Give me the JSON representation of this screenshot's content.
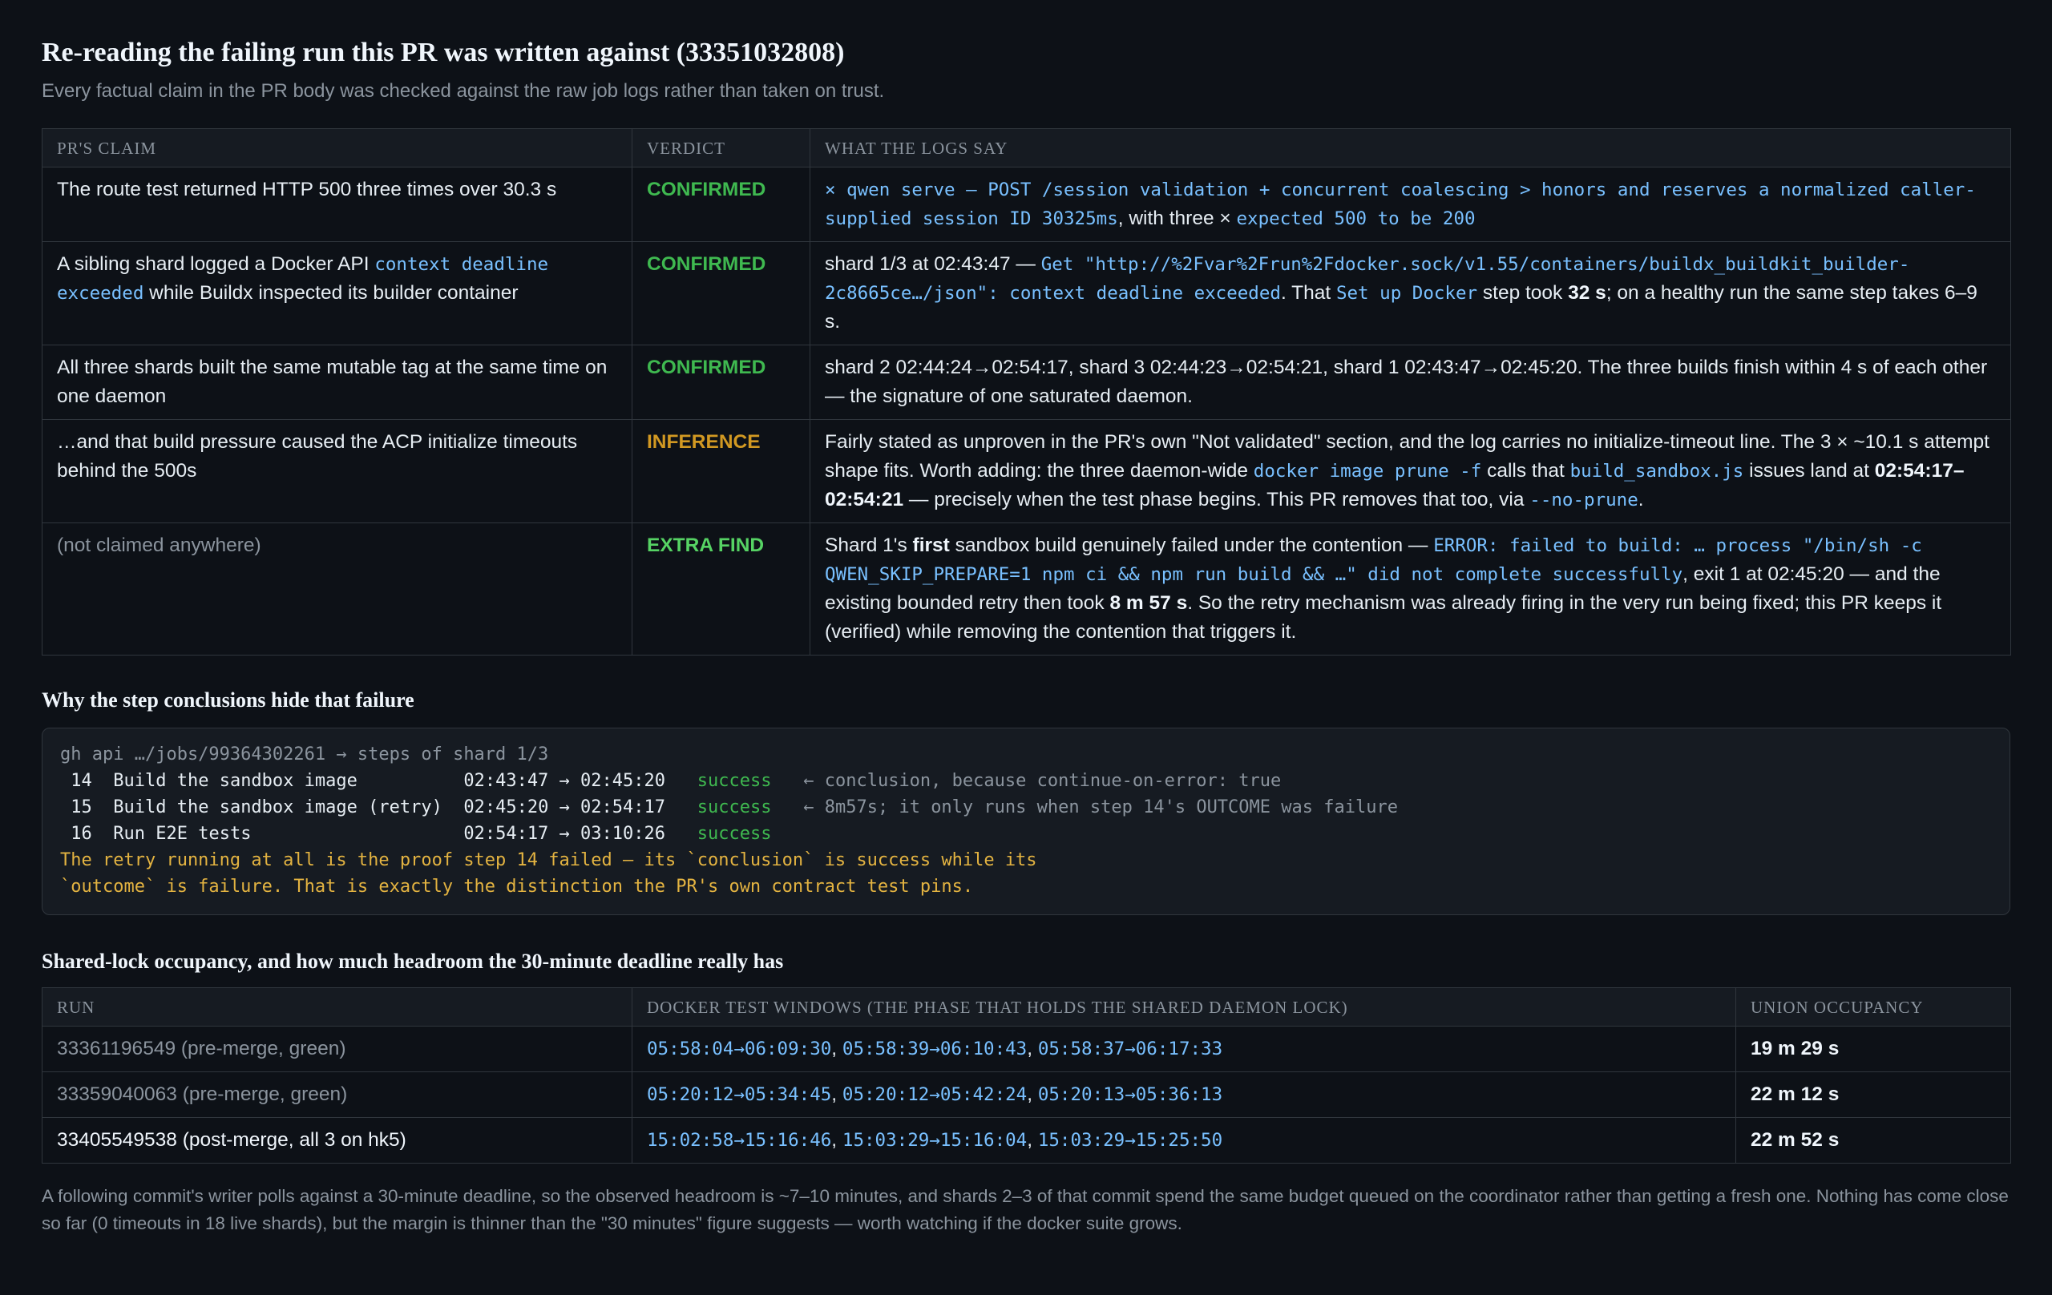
{
  "header": {
    "title": "Re-reading the failing run this PR was written against (33351032808)",
    "subtitle": "Every factual claim in the PR body was checked against the raw job logs rather than taken on trust."
  },
  "claims_table": {
    "headers": [
      "PR's claim",
      "Verdict",
      "What the logs say"
    ],
    "rows": [
      {
        "claim": [
          "The route test returned HTTP 500 three times over 30.3 s"
        ],
        "verdict": "CONFIRMED",
        "logs": [
          "× qwen serve — POST /session validation + concurrent coalescing > honors and reserves a normalized caller-supplied session ID 30325ms",
          ", with three × ",
          "expected 500 to be 200"
        ]
      },
      {
        "claim": [
          "A sibling shard logged a Docker API ",
          "context deadline exceeded",
          " while Buildx inspected its builder container"
        ],
        "verdict": "CONFIRMED",
        "logs": [
          "shard 1/3 at 02:43:47 — ",
          "Get \"http://%2Fvar%2Frun%2Fdocker.sock/v1.55/containers/buildx_buildkit_builder-2c8665ce…/json\": context deadline exceeded",
          ". That ",
          "Set up Docker",
          " step took ",
          "32 s",
          "; on a healthy run the same step takes 6–9 s."
        ]
      },
      {
        "claim": [
          "All three shards built the same mutable tag at the same time on one daemon"
        ],
        "verdict": "CONFIRMED",
        "logs": [
          "shard 2 02:44:24→02:54:17, shard 3 02:44:23→02:54:21, shard 1 02:43:47→02:45:20. The three builds finish within 4 s of each other — the signature of one saturated daemon."
        ]
      },
      {
        "claim": [
          "…and that build pressure caused the ACP initialize timeouts behind the 500s"
        ],
        "verdict": "INFERENCE",
        "logs": [
          "Fairly stated as unproven in the PR's own \"Not validated\" section, and the log carries no initialize-timeout line. The 3 × ~10.1 s attempt shape fits. Worth adding: the three daemon-wide ",
          "docker image prune -f",
          " calls that ",
          "build_sandbox.js",
          " issues land at ",
          "02:54:17–02:54:21",
          " — precisely when the test phase begins. This PR removes that too, via ",
          "--no-prune",
          "."
        ]
      },
      {
        "claim": [
          "(not claimed anywhere)"
        ],
        "verdict": "EXTRA FIND",
        "logs": [
          "Shard 1's ",
          "first",
          " sandbox build genuinely failed under the contention — ",
          "ERROR: failed to build: … process \"/bin/sh -c QWEN_SKIP_PREPARE=1 npm ci && npm run build && …\" did not complete successfully",
          ", exit 1 at 02:45:20 — and the existing bounded retry then took ",
          "8 m 57 s",
          ". So the retry mechanism was already firing in the very run being fixed; this PR keeps it (verified) while removing the contention that triggers it."
        ]
      }
    ]
  },
  "steps_section": {
    "title": "Why the step conclusions hide that failure",
    "command": "gh api …/jobs/99364302261 → steps of shard 1/3",
    "steps": [
      {
        "num": "14",
        "name": "Build the sandbox image",
        "span": "02:43:47 → 02:45:20",
        "status": "success",
        "note": "← conclusion, because continue-on-error: true"
      },
      {
        "num": "15",
        "name": "Build the sandbox image (retry)",
        "span": "02:45:20 → 02:54:17",
        "status": "success",
        "note": "← 8m57s; it only runs when step 14's OUTCOME was failure"
      },
      {
        "num": "16",
        "name": "Run E2E tests",
        "span": "02:54:17 → 03:10:26",
        "status": "success",
        "note": ""
      }
    ],
    "conclusion_lines": [
      "The retry running at all is the proof step 14 failed — its `conclusion` is success while its",
      "`outcome` is failure. That is exactly the distinction the PR's own contract test pins."
    ]
  },
  "occupancy_section": {
    "title": "Shared-lock occupancy, and how much headroom the 30-minute deadline really has",
    "headers": [
      "Run",
      "Docker test windows (the phase that holds the shared daemon lock)",
      "Union occupancy"
    ],
    "rows": [
      {
        "run": "33361196549 (pre-merge, green)",
        "windows": [
          "05:58:04→06:09:30",
          "05:58:39→06:10:43",
          "05:58:37→06:17:33"
        ],
        "union": "19 m 29 s"
      },
      {
        "run": "33359040063 (pre-merge, green)",
        "windows": [
          "05:20:12→05:34:45",
          "05:20:12→05:42:24",
          "05:20:13→05:36:13"
        ],
        "union": "22 m 12 s"
      },
      {
        "run": "33405549538 (post-merge, all 3 on hk5)",
        "windows": [
          "15:02:58→15:16:46",
          "15:03:29→15:16:04",
          "15:03:29→15:25:50"
        ],
        "union": "22 m 52 s"
      }
    ],
    "window_separator": ", ",
    "footnote": "A following commit's writer polls against a 30-minute deadline, so the observed headroom is ~7–10 minutes, and shards 2–3 of that commit spend the same budget queued on the coordinator rather than getting a fresh one. Nothing has come close so far (0 timeouts in 18 live shards), but the margin is thinner than the \"30 minutes\" figure suggests — worth watching if the docker suite grows."
  },
  "colors": {
    "background": "#0d1117",
    "border": "#30363d",
    "code_blue": "#79c0ff",
    "confirmed_green": "#3fb950",
    "inference_amber": "#d29922",
    "warning_yellow": "#e3b341"
  }
}
